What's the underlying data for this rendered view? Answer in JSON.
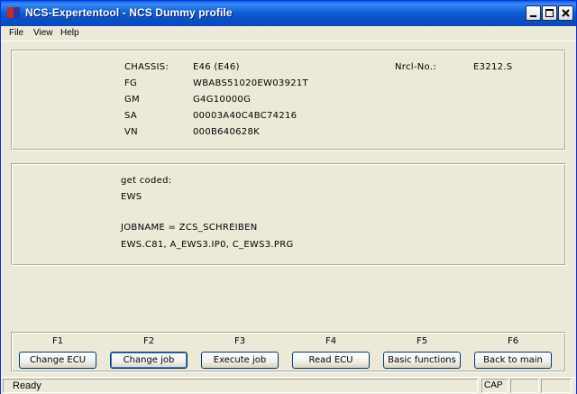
{
  "window": {
    "title": "NCS-Expertentool - NCS Dummy profile"
  },
  "menu": {
    "file": "File",
    "view": "View",
    "help": "Help"
  },
  "vehicle": {
    "chassis_label": "CHASSIS:",
    "chassis_value": "E46 (E46)",
    "fg_label": "FG",
    "fg_value": "WBABS51020EW03921T",
    "gm_label": "GM",
    "gm_value": "G4G10000G",
    "sa_label": "SA",
    "sa_value": "00003A40C4BC74216",
    "vn_label": "VN",
    "vn_value": "000B640628K",
    "nrcl_label": "Nrcl-No.:",
    "nrcl_value": "E3212.S"
  },
  "job": {
    "get_coded": "get coded:",
    "ecu": "EWS",
    "jobname": "JOBNAME = ZCS_SCHREIBEN",
    "files": "EWS.C81, A_EWS3.IP0, C_EWS3.PRG"
  },
  "function_keys": [
    {
      "key": "F1",
      "label": "Change ECU"
    },
    {
      "key": "F2",
      "label": "Change job"
    },
    {
      "key": "F3",
      "label": "Execute job"
    },
    {
      "key": "F4",
      "label": "Read ECU"
    },
    {
      "key": "F5",
      "label": "Basic functions"
    },
    {
      "key": "F6",
      "label": "Back to main"
    }
  ],
  "status": {
    "text": "Ready",
    "cap": "CAP"
  },
  "colors": {
    "titlebar": "#0b4fc6",
    "window_bg": "#ece9d8",
    "button_border": "#003c74"
  }
}
